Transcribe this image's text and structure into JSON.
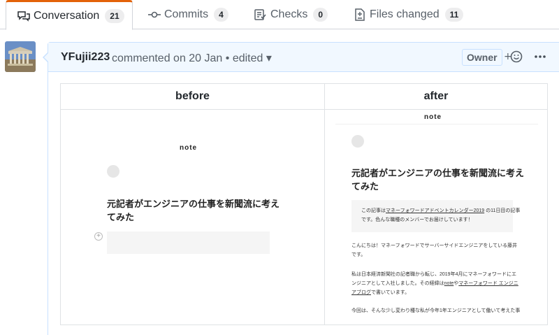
{
  "tabs": [
    {
      "label": "Conversation",
      "count": "21",
      "icon": "conversation-icon"
    },
    {
      "label": "Commits",
      "count": "4",
      "icon": "commit-icon"
    },
    {
      "label": "Checks",
      "count": "0",
      "icon": "checklist-icon"
    },
    {
      "label": "Files changed",
      "count": "11",
      "icon": "file-diff-icon"
    }
  ],
  "comment": {
    "author": "YFujii223",
    "meta": "commented on 20 Jan • edited ▾",
    "owner_badge": "Owner",
    "reaction_icon": "smiley-icon",
    "more_icon": "kebab-icon"
  },
  "table": {
    "before_header": "before",
    "after_header": "after"
  },
  "before": {
    "logo": "note",
    "title_line1": "元記者がエンジニアの仕事を新聞流に考え",
    "title_line2": "てみた"
  },
  "after": {
    "logo": "note",
    "title_line1": "元記者がエンジニアの仕事を新聞流に考え",
    "title_line2": "てみた",
    "box_line1_a": "この記事は",
    "box_line1_link": "マネーフォワードアドベントカレンダー2019",
    "box_line1_b": " の11日目の記事",
    "box_line2": "です。色んな職種のメンバーでお届けしています！",
    "para1_line1": "こんにちは！マネーフォワードでサーバーサイドエンジニアをしている藤井",
    "para1_line2": "です。",
    "para2_line1": "私は日本経済新聞社の記者職から転じ、2019年4月にマネーフォワードにエ",
    "para2_line2_a": "ンジニアとして入社しました。その経緯は",
    "para2_line2_link1": "note",
    "para2_line2_b": "や",
    "para2_line2_link2": "マネーフォワード エンジニ",
    "para2_line3_link": "アブログ",
    "para2_line3_b": "で書いています。",
    "para3_line1": "今回は、そんな少し変わり種な私が今年1年エンジニアとして働いて考えた事"
  },
  "colors": {
    "accent_tab": "#e36209",
    "comment_header_bg": "#f1f8ff",
    "comment_border": "#c8e1ff"
  }
}
